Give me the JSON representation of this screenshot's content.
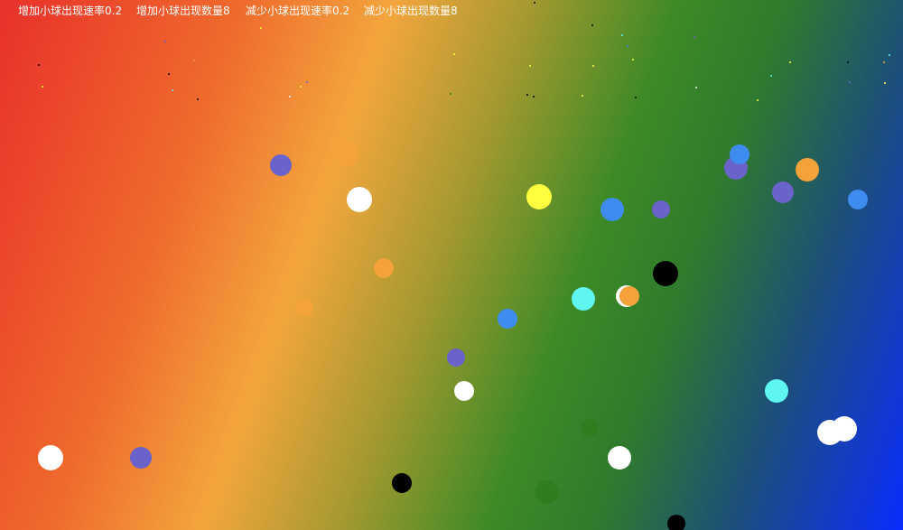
{
  "controls": {
    "increase_rate": "增加小球出现速率0.2",
    "increase_count": "增加小球出现数量8",
    "decrease_rate": "减少小球出现速率0.2",
    "decrease_count": "减少小球出现数量8"
  },
  "palette": {
    "gradient": [
      "#e8302a",
      "#f3a63d",
      "#3d8a26",
      "#0a2cff"
    ],
    "ball_colors": [
      "#ffffff",
      "#6a63c9",
      "#f3a33a",
      "#ffff40",
      "#3f8cf0",
      "#5ff5f0",
      "#000000",
      "#2e7d1e"
    ]
  },
  "balls_visible": 37
}
